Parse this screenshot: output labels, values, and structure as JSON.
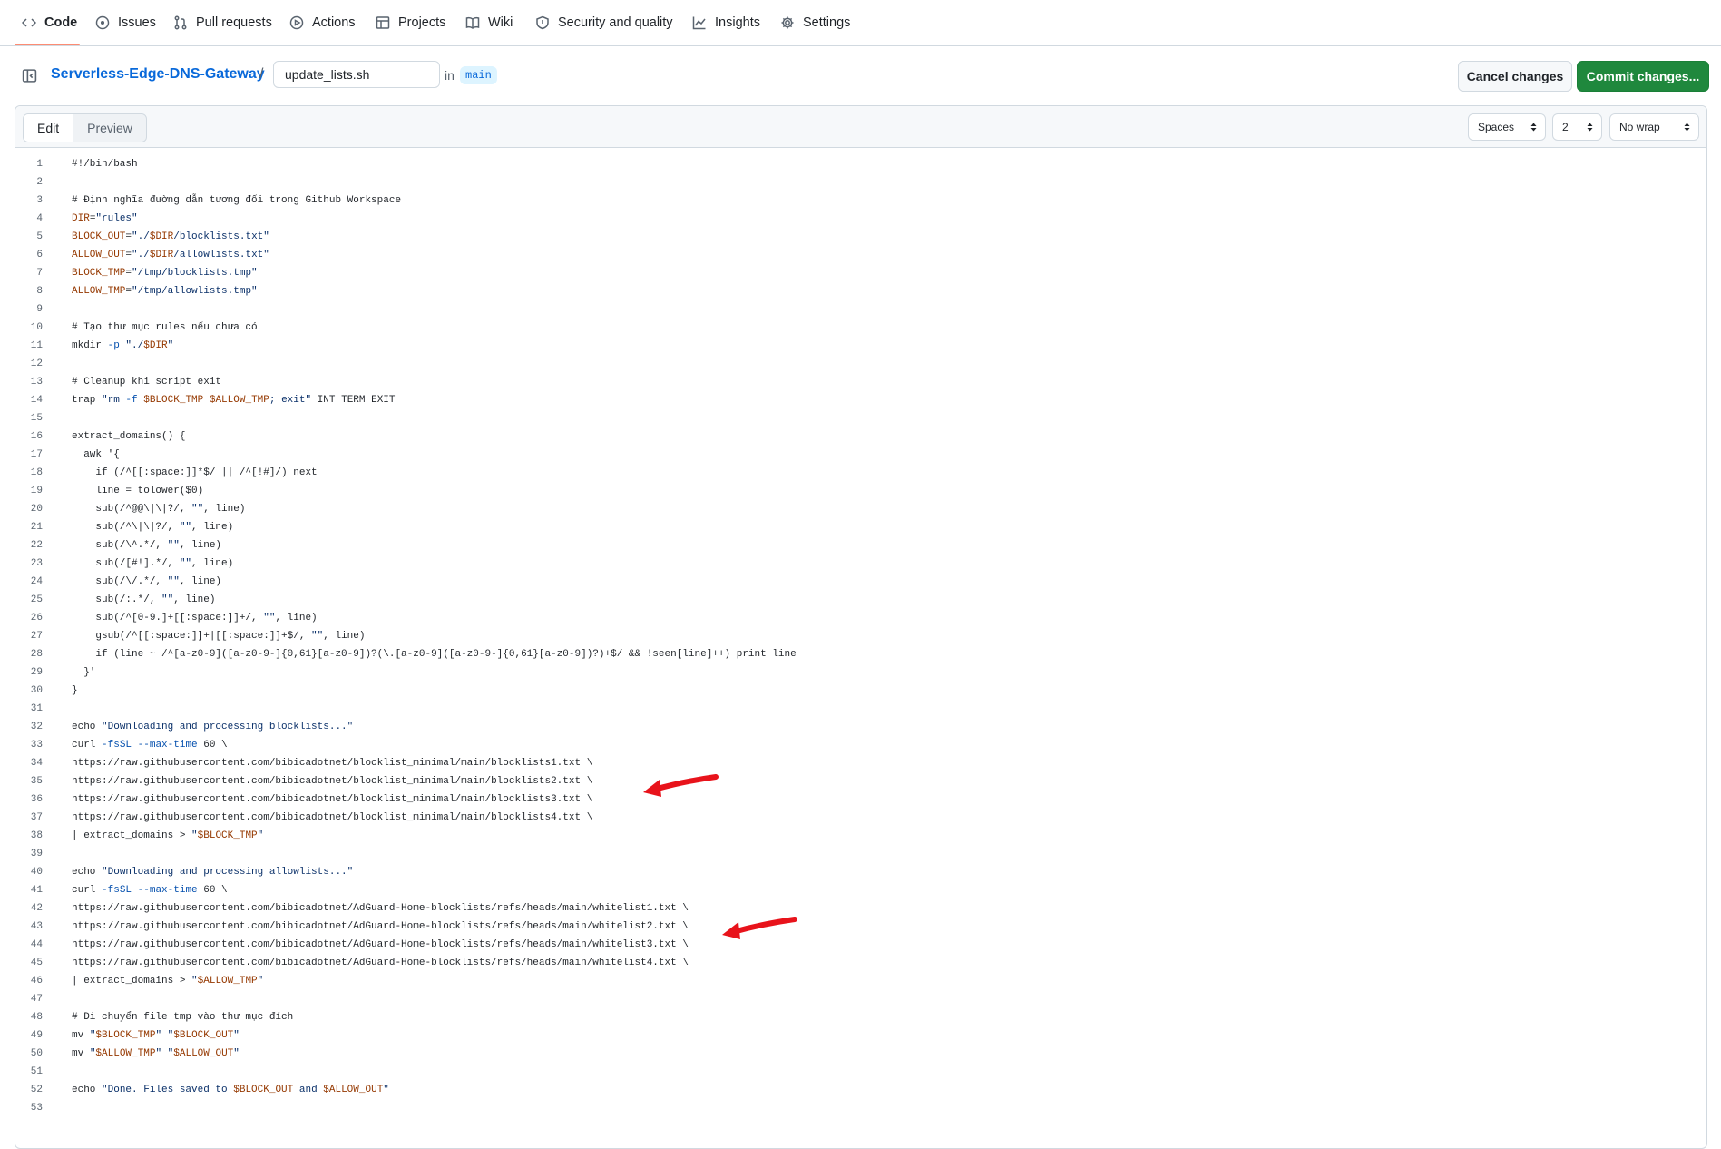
{
  "nav": {
    "tabs": [
      {
        "label": "Code",
        "icon": "code-icon"
      },
      {
        "label": "Issues",
        "icon": "issue-icon"
      },
      {
        "label": "Pull requests",
        "icon": "pull-request-icon"
      },
      {
        "label": "Actions",
        "icon": "play-icon"
      },
      {
        "label": "Projects",
        "icon": "table-icon"
      },
      {
        "label": "Wiki",
        "icon": "book-icon"
      },
      {
        "label": "Security and quality",
        "icon": "shield-icon"
      },
      {
        "label": "Insights",
        "icon": "graph-icon"
      },
      {
        "label": "Settings",
        "icon": "gear-icon"
      }
    ],
    "active_tab": "Code"
  },
  "header": {
    "repo": "Serverless-Edge-DNS-Gateway",
    "separator": "/",
    "filename": "update_lists.sh",
    "in_label": "in",
    "branch": "main",
    "cancel_label": "Cancel changes",
    "commit_label": "Commit changes..."
  },
  "editor": {
    "modes": [
      "Edit",
      "Preview"
    ],
    "active_mode": "Edit",
    "indent_mode": "Spaces",
    "indent_size": "2",
    "wrap_mode": "No wrap"
  },
  "code_lines": [
    "#!/bin/bash",
    "",
    "# Định nghĩa đường dẫn tương đối trong Github Workspace",
    "DIR=\"rules\"",
    "BLOCK_OUT=\"./$DIR/blocklists.txt\"",
    "ALLOW_OUT=\"./$DIR/allowlists.txt\"",
    "BLOCK_TMP=\"/tmp/blocklists.tmp\"",
    "ALLOW_TMP=\"/tmp/allowlists.tmp\"",
    "",
    "# Tạo thư mục rules nếu chưa có",
    "mkdir -p \"./$DIR\"",
    "",
    "# Cleanup khi script exit",
    "trap \"rm -f $BLOCK_TMP $ALLOW_TMP; exit\" INT TERM EXIT",
    "",
    "extract_domains() {",
    "  awk '{",
    "    if (/^[[:space:]]*$/ || /^[!#]/) next",
    "    line = tolower($0)",
    "    sub(/^@@\\|\\|?/, \"\", line)",
    "    sub(/^\\|\\|?/, \"\", line)",
    "    sub(/\\^.*/, \"\", line)",
    "    sub(/[#!].*/, \"\", line)",
    "    sub(/\\/.*/, \"\", line)",
    "    sub(/:.*/, \"\", line)",
    "    sub(/^[0-9.]+[[:space:]]+/, \"\", line)",
    "    gsub(/^[[:space:]]+|[[:space:]]+$/, \"\", line)",
    "    if (line ~ /^[a-z0-9]([a-z0-9-]{0,61}[a-z0-9])?(\\.[a-z0-9]([a-z0-9-]{0,61}[a-z0-9])?)+$/ && !seen[line]++) print line",
    "  }'",
    "}",
    "",
    "echo \"Downloading and processing blocklists...\"",
    "curl -fsSL --max-time 60 \\",
    "https://raw.githubusercontent.com/bibicadotnet/blocklist_minimal/main/blocklists1.txt \\",
    "https://raw.githubusercontent.com/bibicadotnet/blocklist_minimal/main/blocklists2.txt \\",
    "https://raw.githubusercontent.com/bibicadotnet/blocklist_minimal/main/blocklists3.txt \\",
    "https://raw.githubusercontent.com/bibicadotnet/blocklist_minimal/main/blocklists4.txt \\",
    "| extract_domains > \"$BLOCK_TMP\"",
    "",
    "echo \"Downloading and processing allowlists...\"",
    "curl -fsSL --max-time 60 \\",
    "https://raw.githubusercontent.com/bibicadotnet/AdGuard-Home-blocklists/refs/heads/main/whitelist1.txt \\",
    "https://raw.githubusercontent.com/bibicadotnet/AdGuard-Home-blocklists/refs/heads/main/whitelist2.txt \\",
    "https://raw.githubusercontent.com/bibicadotnet/AdGuard-Home-blocklists/refs/heads/main/whitelist3.txt \\",
    "https://raw.githubusercontent.com/bibicadotnet/AdGuard-Home-blocklists/refs/heads/main/whitelist4.txt \\",
    "| extract_domains > \"$ALLOW_TMP\"",
    "",
    "# Di chuyển file tmp vào thư mục đích",
    "mv \"$BLOCK_TMP\" \"$BLOCK_OUT\"",
    "mv \"$ALLOW_TMP\" \"$ALLOW_OUT\"",
    "",
    "echo \"Done. Files saved to $BLOCK_OUT and $ALLOW_OUT\"",
    ""
  ],
  "annotations": {
    "arrow_color": "#e8131b",
    "arrow_lines": [
      35,
      43
    ]
  },
  "colors": {
    "accent_link": "#0969da",
    "commit_green": "#1f883d",
    "tab_underline": "#fd8c73"
  }
}
